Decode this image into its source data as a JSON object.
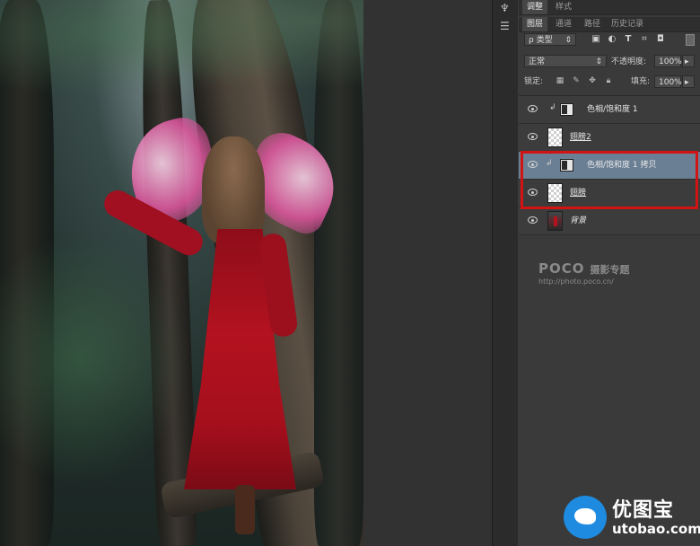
{
  "panel": {
    "top_tabs": [
      "调整",
      "样式"
    ],
    "tabs": [
      "图层",
      "通道",
      "路径",
      "历史记录"
    ],
    "active_tab": "图层",
    "filter_kind": "ρ 类型",
    "blend_mode": "正常",
    "opacity_label": "不透明度:",
    "opacity_value": "100%",
    "lock_label": "锁定:",
    "fill_label": "填充:",
    "fill_value": "100%",
    "filter_icons": [
      "image-filter-icon",
      "adjustment-filter-icon",
      "type-filter-icon",
      "shape-filter-icon",
      "smart-object-filter-icon"
    ],
    "lock_icons": [
      "lock-transparent-icon",
      "lock-image-icon",
      "lock-position-icon",
      "lock-all-icon"
    ]
  },
  "layers": [
    {
      "name": "色相/饱和度 1",
      "kind": "adjustment",
      "clipped": true,
      "selected": false,
      "underline": false,
      "italic": false
    },
    {
      "name": "翅膀2",
      "kind": "pixel",
      "clipped": false,
      "selected": false,
      "underline": true,
      "italic": false
    },
    {
      "name": "色相/饱和度 1 拷贝",
      "kind": "adjustment",
      "clipped": true,
      "selected": true,
      "underline": false,
      "italic": false
    },
    {
      "name": "翅膀",
      "kind": "pixel",
      "clipped": false,
      "selected": false,
      "underline": true,
      "italic": false
    },
    {
      "name": "背景",
      "kind": "photo",
      "clipped": false,
      "selected": false,
      "underline": false,
      "italic": true
    }
  ],
  "watermark": {
    "poco": "POCO",
    "poco_sub": "摄影专题",
    "poco_url": "http://photo.poco.cn/",
    "site_title": "优图宝",
    "site_url": "utobao.com"
  },
  "colors": {
    "highlight": "#d21313",
    "selected_layer": "#6b7f94",
    "dress": "#b3121f",
    "wm_blue": "#1e8be0"
  }
}
